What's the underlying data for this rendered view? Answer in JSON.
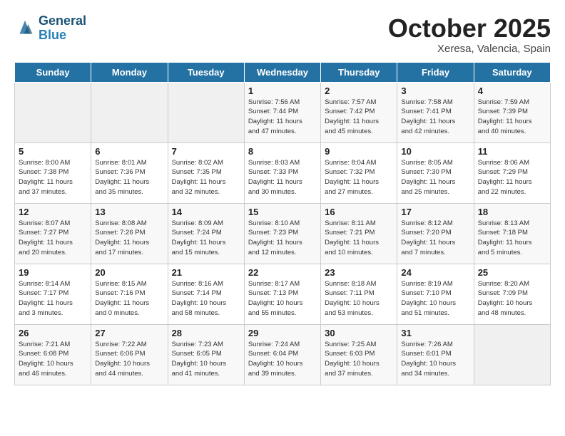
{
  "header": {
    "logo_line1": "General",
    "logo_line2": "Blue",
    "month": "October 2025",
    "location": "Xeresa, Valencia, Spain"
  },
  "days_of_week": [
    "Sunday",
    "Monday",
    "Tuesday",
    "Wednesday",
    "Thursday",
    "Friday",
    "Saturday"
  ],
  "weeks": [
    [
      {
        "day": "",
        "info": ""
      },
      {
        "day": "",
        "info": ""
      },
      {
        "day": "",
        "info": ""
      },
      {
        "day": "1",
        "info": "Sunrise: 7:56 AM\nSunset: 7:44 PM\nDaylight: 11 hours\nand 47 minutes."
      },
      {
        "day": "2",
        "info": "Sunrise: 7:57 AM\nSunset: 7:42 PM\nDaylight: 11 hours\nand 45 minutes."
      },
      {
        "day": "3",
        "info": "Sunrise: 7:58 AM\nSunset: 7:41 PM\nDaylight: 11 hours\nand 42 minutes."
      },
      {
        "day": "4",
        "info": "Sunrise: 7:59 AM\nSunset: 7:39 PM\nDaylight: 11 hours\nand 40 minutes."
      }
    ],
    [
      {
        "day": "5",
        "info": "Sunrise: 8:00 AM\nSunset: 7:38 PM\nDaylight: 11 hours\nand 37 minutes."
      },
      {
        "day": "6",
        "info": "Sunrise: 8:01 AM\nSunset: 7:36 PM\nDaylight: 11 hours\nand 35 minutes."
      },
      {
        "day": "7",
        "info": "Sunrise: 8:02 AM\nSunset: 7:35 PM\nDaylight: 11 hours\nand 32 minutes."
      },
      {
        "day": "8",
        "info": "Sunrise: 8:03 AM\nSunset: 7:33 PM\nDaylight: 11 hours\nand 30 minutes."
      },
      {
        "day": "9",
        "info": "Sunrise: 8:04 AM\nSunset: 7:32 PM\nDaylight: 11 hours\nand 27 minutes."
      },
      {
        "day": "10",
        "info": "Sunrise: 8:05 AM\nSunset: 7:30 PM\nDaylight: 11 hours\nand 25 minutes."
      },
      {
        "day": "11",
        "info": "Sunrise: 8:06 AM\nSunset: 7:29 PM\nDaylight: 11 hours\nand 22 minutes."
      }
    ],
    [
      {
        "day": "12",
        "info": "Sunrise: 8:07 AM\nSunset: 7:27 PM\nDaylight: 11 hours\nand 20 minutes."
      },
      {
        "day": "13",
        "info": "Sunrise: 8:08 AM\nSunset: 7:26 PM\nDaylight: 11 hours\nand 17 minutes."
      },
      {
        "day": "14",
        "info": "Sunrise: 8:09 AM\nSunset: 7:24 PM\nDaylight: 11 hours\nand 15 minutes."
      },
      {
        "day": "15",
        "info": "Sunrise: 8:10 AM\nSunset: 7:23 PM\nDaylight: 11 hours\nand 12 minutes."
      },
      {
        "day": "16",
        "info": "Sunrise: 8:11 AM\nSunset: 7:21 PM\nDaylight: 11 hours\nand 10 minutes."
      },
      {
        "day": "17",
        "info": "Sunrise: 8:12 AM\nSunset: 7:20 PM\nDaylight: 11 hours\nand 7 minutes."
      },
      {
        "day": "18",
        "info": "Sunrise: 8:13 AM\nSunset: 7:18 PM\nDaylight: 11 hours\nand 5 minutes."
      }
    ],
    [
      {
        "day": "19",
        "info": "Sunrise: 8:14 AM\nSunset: 7:17 PM\nDaylight: 11 hours\nand 3 minutes."
      },
      {
        "day": "20",
        "info": "Sunrise: 8:15 AM\nSunset: 7:16 PM\nDaylight: 11 hours\nand 0 minutes."
      },
      {
        "day": "21",
        "info": "Sunrise: 8:16 AM\nSunset: 7:14 PM\nDaylight: 10 hours\nand 58 minutes."
      },
      {
        "day": "22",
        "info": "Sunrise: 8:17 AM\nSunset: 7:13 PM\nDaylight: 10 hours\nand 55 minutes."
      },
      {
        "day": "23",
        "info": "Sunrise: 8:18 AM\nSunset: 7:11 PM\nDaylight: 10 hours\nand 53 minutes."
      },
      {
        "day": "24",
        "info": "Sunrise: 8:19 AM\nSunset: 7:10 PM\nDaylight: 10 hours\nand 51 minutes."
      },
      {
        "day": "25",
        "info": "Sunrise: 8:20 AM\nSunset: 7:09 PM\nDaylight: 10 hours\nand 48 minutes."
      }
    ],
    [
      {
        "day": "26",
        "info": "Sunrise: 7:21 AM\nSunset: 6:08 PM\nDaylight: 10 hours\nand 46 minutes."
      },
      {
        "day": "27",
        "info": "Sunrise: 7:22 AM\nSunset: 6:06 PM\nDaylight: 10 hours\nand 44 minutes."
      },
      {
        "day": "28",
        "info": "Sunrise: 7:23 AM\nSunset: 6:05 PM\nDaylight: 10 hours\nand 41 minutes."
      },
      {
        "day": "29",
        "info": "Sunrise: 7:24 AM\nSunset: 6:04 PM\nDaylight: 10 hours\nand 39 minutes."
      },
      {
        "day": "30",
        "info": "Sunrise: 7:25 AM\nSunset: 6:03 PM\nDaylight: 10 hours\nand 37 minutes."
      },
      {
        "day": "31",
        "info": "Sunrise: 7:26 AM\nSunset: 6:01 PM\nDaylight: 10 hours\nand 34 minutes."
      },
      {
        "day": "",
        "info": ""
      }
    ]
  ]
}
